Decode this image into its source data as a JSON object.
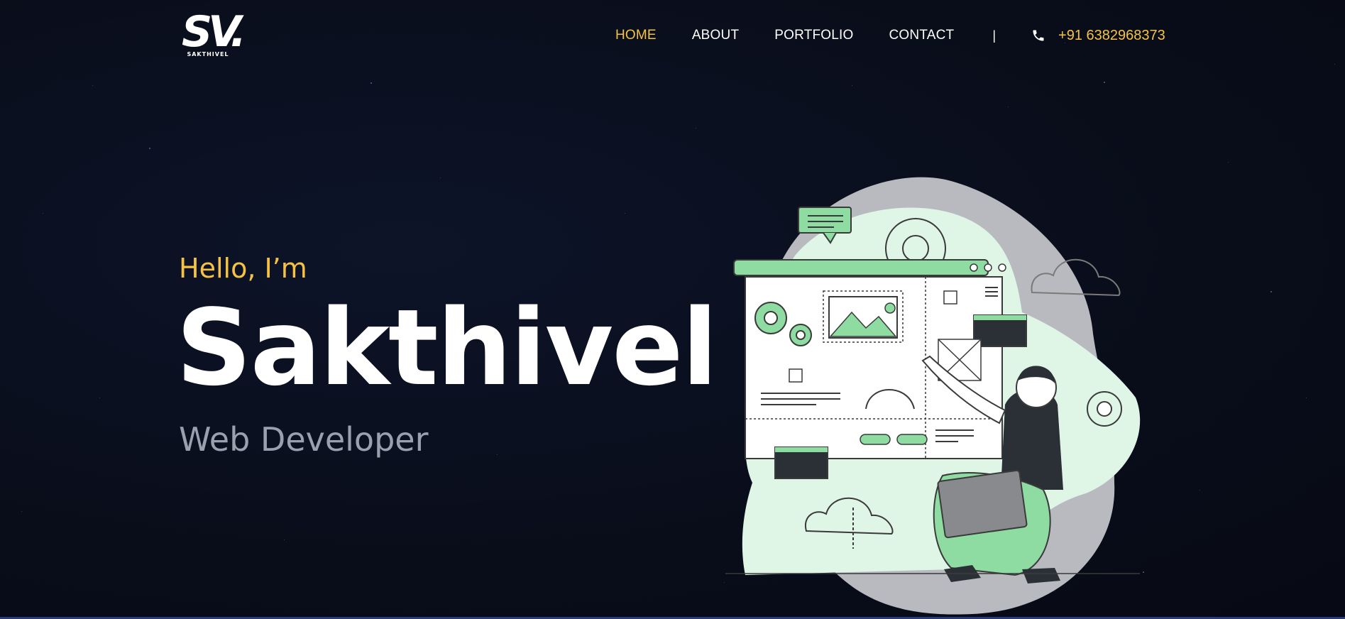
{
  "logo": {
    "mark": "SV.",
    "sub": "SAKTHIVEL"
  },
  "nav": {
    "items": [
      {
        "label": "HOME",
        "active": true
      },
      {
        "label": "ABOUT",
        "active": false
      },
      {
        "label": "PORTFOLIO",
        "active": false
      },
      {
        "label": "CONTACT",
        "active": false
      }
    ],
    "divider": "|",
    "phone_icon": "phone-icon",
    "phone": "+91 6382968373"
  },
  "hero": {
    "greeting": "Hello, I’m",
    "name": "Sakthivel",
    "role": "Web Developer"
  },
  "illustration": {
    "icon": "developer-illustration"
  },
  "colors": {
    "accent": "#f6c244",
    "background": "#0a0e1c",
    "green": "#8fdca3",
    "light_green": "#dff5e6",
    "gray_blob": "#b9bac0"
  }
}
